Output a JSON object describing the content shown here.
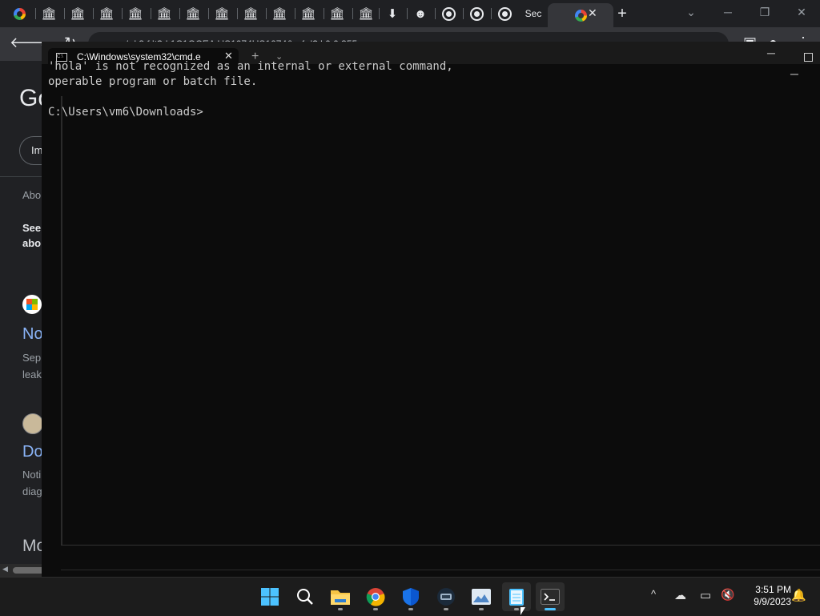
{
  "chrome": {
    "tabs": [
      {
        "icon": "google-icon"
      },
      {
        "icon": "bank-icon",
        "glyph": "🏛"
      },
      {
        "icon": "bank-icon",
        "glyph": "🏛"
      },
      {
        "icon": "bank-icon",
        "glyph": "🏛"
      },
      {
        "icon": "bank-icon",
        "glyph": "🏛"
      },
      {
        "icon": "bank-icon",
        "glyph": "🏛"
      },
      {
        "icon": "bank-icon",
        "glyph": "🏛"
      },
      {
        "icon": "bank-icon",
        "glyph": "🏛"
      },
      {
        "icon": "bank-icon",
        "glyph": "🏛"
      },
      {
        "icon": "bank-icon",
        "glyph": "🏛"
      },
      {
        "icon": "bank-icon",
        "glyph": "🏛"
      },
      {
        "icon": "bank-icon",
        "glyph": "🏛"
      },
      {
        "icon": "bank-icon",
        "glyph": "🏛"
      },
      {
        "icon": "download-icon",
        "glyph": "⬇"
      },
      {
        "icon": "smiley-icon",
        "glyph": "☻"
      },
      {
        "icon": "chrome-icon"
      },
      {
        "icon": "chrome-icon"
      },
      {
        "icon": "chrome-icon"
      }
    ],
    "text_tab_label": "Sec",
    "new_tab_glyph": "+",
    "close_glyph": "✕",
    "omnibox_text": "a                        a/      d 3                    f      lt?rl      1C1GCEA      US1074US1074&              r        f  d?     l          0 0;355"
  },
  "google_page": {
    "logo_text": "Go",
    "chip_text": "Im",
    "about_text": "Abo",
    "see_text": [
      "See",
      "abo"
    ],
    "result1_title": "No",
    "result1_snippet": [
      "Sep",
      "leak"
    ],
    "result2_title": "Do",
    "result2_snippet": [
      "Noti",
      "diag"
    ],
    "more_text": "More to as"
  },
  "terminal": {
    "tab_title": "C:\\Windows\\system32\\cmd.e",
    "tab_icon_label": "C:\\",
    "new_tab_glyph": "+",
    "dropdown_glyph": "⌄",
    "lines": [
      "'hola' is not recognized as an internal or external command,",
      "operable program or batch file.",
      "",
      "C:\\Users\\vm6\\Downloads>"
    ]
  },
  "taskbar": {
    "apps": [
      {
        "name": "start",
        "active": false
      },
      {
        "name": "search",
        "active": false
      },
      {
        "name": "file-explorer",
        "active": false
      },
      {
        "name": "chrome",
        "active": false
      },
      {
        "name": "defender",
        "active": false
      },
      {
        "name": "app-vm",
        "active": false
      },
      {
        "name": "photos",
        "active": false
      },
      {
        "name": "notepad",
        "active": true
      },
      {
        "name": "terminal",
        "active": true
      }
    ],
    "tray": {
      "chevron": "^",
      "cloud_glyph": "☁",
      "monitor_glyph": "▭",
      "speaker_glyph": "🔇",
      "bell_glyph": "🔔"
    },
    "clock_time": "3:51 PM",
    "clock_date": "9/9/2023"
  }
}
